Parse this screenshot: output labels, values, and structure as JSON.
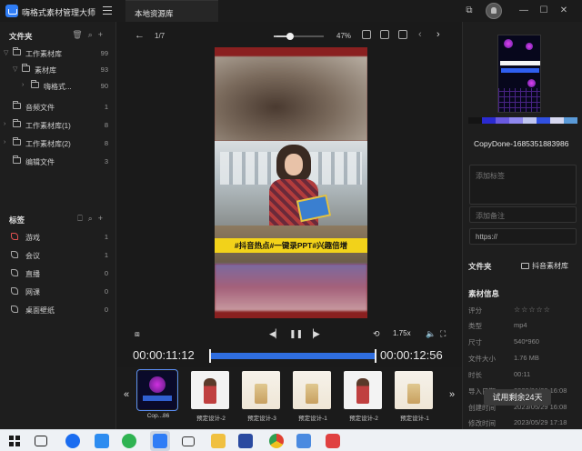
{
  "app": {
    "title": "嗨格式素材管理大师",
    "tab": "本地资源库",
    "window_controls": [
      "⧉",
      "—",
      "☐",
      "✕"
    ]
  },
  "folders": {
    "header": "文件夹",
    "items": [
      {
        "label": "工作素材库",
        "count": "99"
      },
      {
        "label": "素材库",
        "count": "93"
      },
      {
        "label": "嗨格式...",
        "count": "90"
      },
      {
        "label": "音频文件",
        "count": "1"
      },
      {
        "label": "工作素材库(1)",
        "count": "8"
      },
      {
        "label": "工作素材库(2)",
        "count": "8"
      },
      {
        "label": "编辑文件",
        "count": "3"
      }
    ]
  },
  "tags": {
    "header": "标签",
    "items": [
      {
        "label": "游戏",
        "count": "1",
        "color": "#e05050"
      },
      {
        "label": "会议",
        "count": "1",
        "color": "#aaaaaa"
      },
      {
        "label": "直播",
        "count": "0",
        "color": "#aaaaaa"
      },
      {
        "label": "网课",
        "count": "0",
        "color": "#aaaaaa"
      },
      {
        "label": "桌面壁纸",
        "count": "0",
        "color": "#aaaaaa"
      }
    ]
  },
  "viewer": {
    "page_indicator": "1/7",
    "zoom_percent": "47%",
    "zoom_level": 0.28,
    "banner_text": "#抖音热点#一键录PPT#兴趣倍增",
    "speed": "1.75x",
    "current_time": "00:00:11:12",
    "total_time": "00:00:12:56",
    "progress": 0.88
  },
  "filmstrip": {
    "prev": "«",
    "next": "»",
    "items": [
      {
        "caption": "Cop...86",
        "kind": "dark",
        "selected": true
      },
      {
        "caption": "预定设计-2",
        "kind": "girl"
      },
      {
        "caption": "预定设计-3",
        "kind": "desk"
      },
      {
        "caption": "预定设计-1",
        "kind": "desk"
      },
      {
        "caption": "预定设计-2",
        "kind": "girl"
      },
      {
        "caption": "预定设计-1",
        "kind": "desk"
      }
    ]
  },
  "details": {
    "swatches": [
      "#141414",
      "#2a2ad0",
      "#6a5ae0",
      "#8f88ee",
      "#c0c6f0",
      "#3050e0",
      "#d6d8f0",
      "#5a9ad8"
    ],
    "filename": "CopyDone-1685351883986",
    "tag_placeholder": "添加标签",
    "note_placeholder": "添加备注",
    "url_placeholder": "https://",
    "folder_label": "文件夹",
    "folder_value": "抖音素材库",
    "info_label": "素材信息",
    "rows": [
      {
        "key": "评分",
        "value": "☆☆☆☆☆"
      },
      {
        "key": "类型",
        "value": "mp4"
      },
      {
        "key": "尺寸",
        "value": "540*960"
      },
      {
        "key": "文件大小",
        "value": "1.76 MB"
      },
      {
        "key": "时长",
        "value": "00:11"
      },
      {
        "key": "导入日期",
        "value": "2023/01/09 16:08"
      },
      {
        "key": "创建时间",
        "value": "2023/05/29 16:08"
      },
      {
        "key": "修改时间",
        "value": "2023/05/29 17:18"
      }
    ]
  },
  "toast": "试用剩余24天"
}
